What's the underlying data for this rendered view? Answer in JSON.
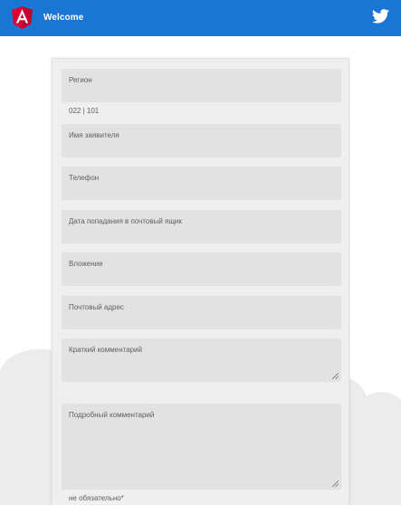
{
  "header": {
    "title": "Welcome",
    "brand_color": "#1976d2",
    "logo_icon": "angular-logo-icon",
    "social_icon": "twitter-icon"
  },
  "form": {
    "fields": [
      {
        "id": "region",
        "label": "Регион",
        "hint": "022 | 101"
      },
      {
        "id": "applicant_name",
        "label": "Имя заявителя"
      },
      {
        "id": "phone",
        "label": "Телефон"
      },
      {
        "id": "mailbox_date",
        "label": "Дата попадания в почтовый ящик"
      },
      {
        "id": "attachment",
        "label": "Вложение"
      },
      {
        "id": "postal_address",
        "label": "Почтовый адрес"
      },
      {
        "id": "short_comment",
        "label": "Краткий комментарий"
      },
      {
        "id": "detailed_comment",
        "label": "Подробный комментарий",
        "hint": "не обязательно*"
      }
    ]
  }
}
